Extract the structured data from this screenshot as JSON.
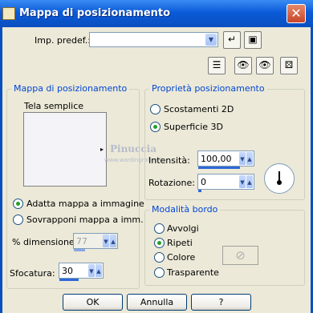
{
  "window": {
    "title": "Mappa di posizionamento",
    "close_glyph": "✕"
  },
  "preset": {
    "label": "Imp. predef.:",
    "value": ""
  },
  "toolbar_icons": [
    "arrow-icon",
    "save-icon",
    "list-icon",
    "eye-lock-icon",
    "eye-icon",
    "dice-icon"
  ],
  "map_group": {
    "title": "Mappa di posizionamento",
    "map_name": "Tela semplice",
    "watermark_name": "Pinuccia",
    "watermark_site": "www.wardingrafica.it",
    "fit_option": "Adatta mappa a immagine",
    "overlay_option": "Sovrapponi mappa a imm.",
    "selected": "fit",
    "size_label": "% dimensione:",
    "size_value": "77",
    "blur_label": "Sfocatura:",
    "blur_value": "30"
  },
  "props_group": {
    "title": "Proprietà posizionamento",
    "offset_option": "Scostamenti 2D",
    "surface_option": "Superficie 3D",
    "selected": "surface",
    "intensity_label": "Intensità:",
    "intensity_value": "100,00",
    "rotation_label": "Rotazione:",
    "rotation_value": "0"
  },
  "edge_group": {
    "title": "Modalità bordo",
    "options": [
      "Avvolgi",
      "Ripeti",
      "Colore",
      "Trasparente"
    ],
    "selected_index": 1
  },
  "buttons": {
    "ok": "OK",
    "cancel": "Annulla",
    "help": "?"
  }
}
